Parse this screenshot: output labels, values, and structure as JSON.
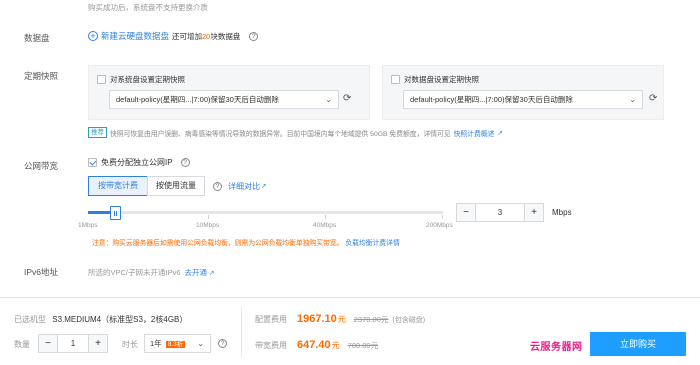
{
  "top_note": "购买成功后，系统盘不支持更换介质",
  "data_disk": {
    "label": "数据盘",
    "add_link": "新建云硬盘数据盘",
    "remaining_prefix": "还可增加",
    "remaining_count": "20",
    "remaining_suffix": "块数据盘"
  },
  "snapshot": {
    "label": "定期快照",
    "system_checkbox": "对系统盘设置定期快照",
    "system_policy": "default-policy(星期四...|7:00)保留30天后自动删除",
    "data_checkbox": "对数据盘设置定期快照",
    "data_policy": "default-policy(星期四...|7:00)保留30天后自动删除",
    "tip_tag": "推荐",
    "tip_text": "快照可恢复由用户误删、病毒感染等情况导致的数据异常。目前中国境内每个地域提供 50GB 免费额度，详情可见",
    "tip_link": "快照计费概述"
  },
  "bandwidth": {
    "label": "公网带宽",
    "assign_ip": "免费分配独立公网IP",
    "tab_bandwidth": "按带宽计费",
    "tab_traffic": "按使用流量",
    "compare_link": "详细对比",
    "ticks": [
      "1Mbps",
      "10Mbps",
      "40Mbps",
      "200Mbps"
    ],
    "slider_value": 3,
    "stepper_value": "3",
    "unit": "Mbps",
    "notice": "注意：购买云服务器后如需使用公网负载均衡，则需为公网负载均衡单独购买带宽。",
    "notice_link": "负载均衡计费详情"
  },
  "ipv6": {
    "label": "IPv6地址",
    "text": "所选的VPC/子网未开通IPv6",
    "link": "去开通"
  },
  "footer": {
    "model_label": "已选机型",
    "model_value": "S3.MEDIUM4（标准型S3，2核4GB）",
    "qty_label": "数量",
    "qty_value": "1",
    "minus": "−",
    "plus": "+",
    "duration_label": "时长",
    "duration_value": "1年",
    "discount": "8.3折",
    "config_fee_label": "配置费用",
    "config_fee": "1967.10",
    "currency": "元",
    "config_fee_orig": "2370.00元",
    "config_fee_note": "(包含磁盘)",
    "bandwidth_fee_label": "带宽费用",
    "bandwidth_fee": "647.40",
    "bandwidth_fee_orig": "780.00元",
    "watermark": "云服务器网",
    "cta_text": "立即购买"
  },
  "colors": {
    "accent": "#2f7fe0",
    "price": "#ff6a00",
    "warning": "#ff6a00",
    "watermark": "#e8218c"
  }
}
